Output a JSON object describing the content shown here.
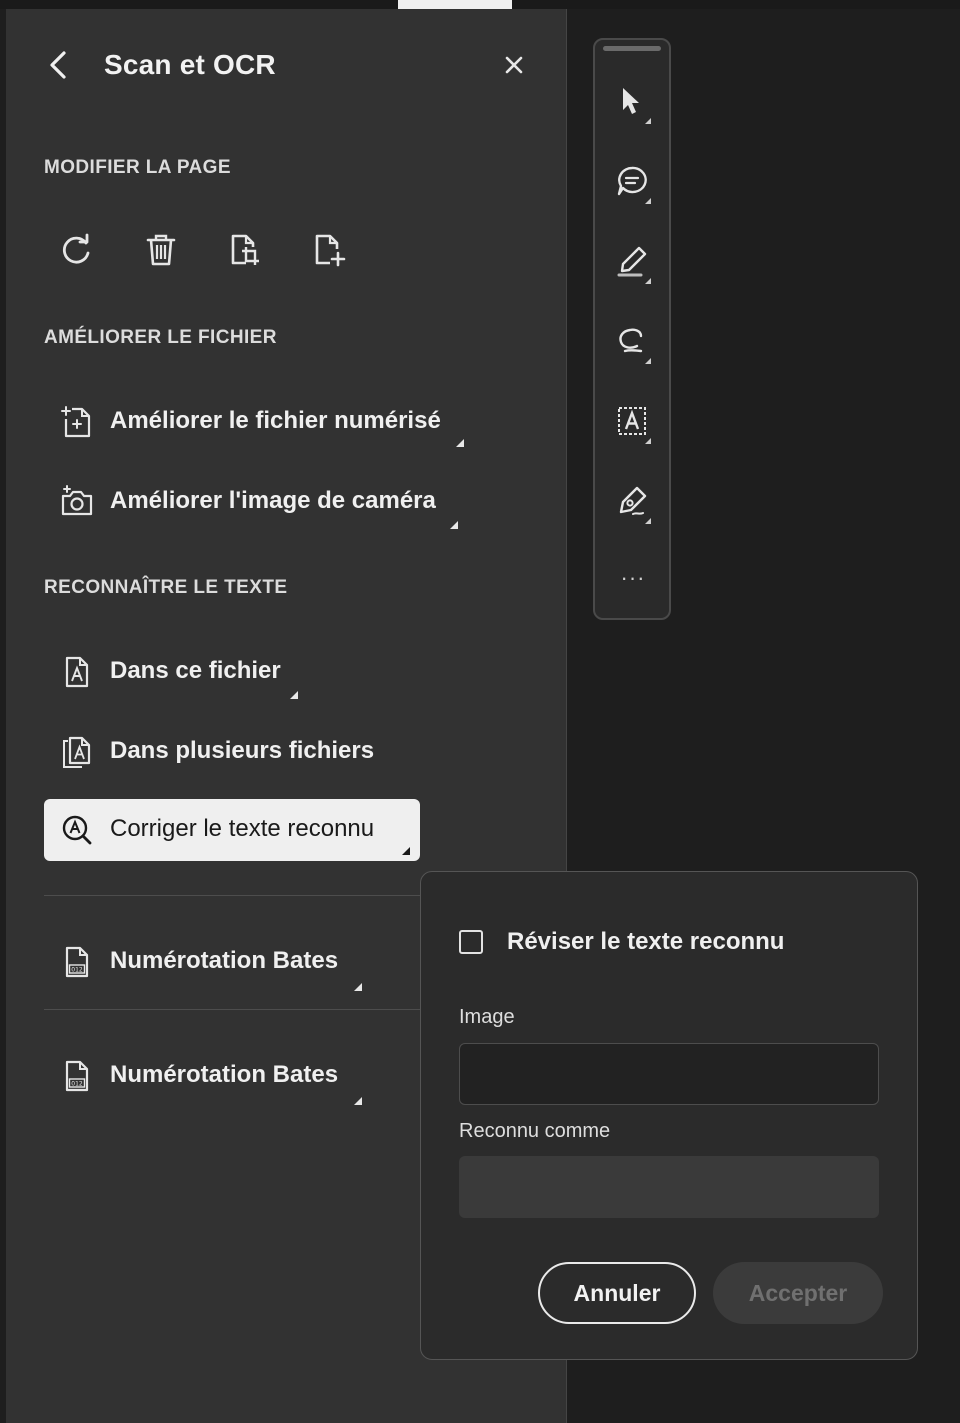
{
  "panel": {
    "title": "Scan et OCR",
    "sections": {
      "modify": "MODIFIER LA PAGE",
      "enhance": "AMÉLIORER LE FICHIER",
      "recognize": "RECONNAÎTRE LE TEXTE"
    },
    "page_tools": [
      "rotate-icon",
      "trash-icon",
      "crop-page-icon",
      "insert-page-icon"
    ],
    "enhance_items": [
      {
        "label": "Améliorer le fichier numérisé",
        "icon": "enhance-scan-icon"
      },
      {
        "label": "Améliorer l'image de caméra",
        "icon": "enhance-camera-icon"
      }
    ],
    "recognize_items": [
      {
        "label": "Dans ce fichier",
        "icon": "ocr-file-icon"
      },
      {
        "label": "Dans plusieurs fichiers",
        "icon": "ocr-multiple-files-icon"
      },
      {
        "label": "Corriger le texte reconnu",
        "icon": "ocr-correct-icon",
        "selected": true
      }
    ],
    "bates_items": [
      {
        "label": "Numérotation Bates",
        "icon": "bates-icon"
      },
      {
        "label": "Numérotation Bates",
        "icon": "bates-icon"
      }
    ]
  },
  "toolbar": {
    "tools": [
      "select-cursor-icon",
      "comment-icon",
      "highlighter-icon",
      "lasso-draw-icon",
      "text-recognition-icon",
      "signature-icon"
    ],
    "more": "···"
  },
  "popover": {
    "checkbox_label": "Réviser le texte reconnu",
    "checkbox_checked": false,
    "image_label": "Image",
    "image_value": "",
    "recognized_label": "Reconnu comme",
    "recognized_value": "",
    "cancel_label": "Annuler",
    "accept_label": "Accepter"
  },
  "colors": {
    "panel_bg": "#323232",
    "canvas_bg": "#1e1e1e",
    "selected_bg": "#efefef",
    "popover_bg": "#2b2b2b"
  }
}
